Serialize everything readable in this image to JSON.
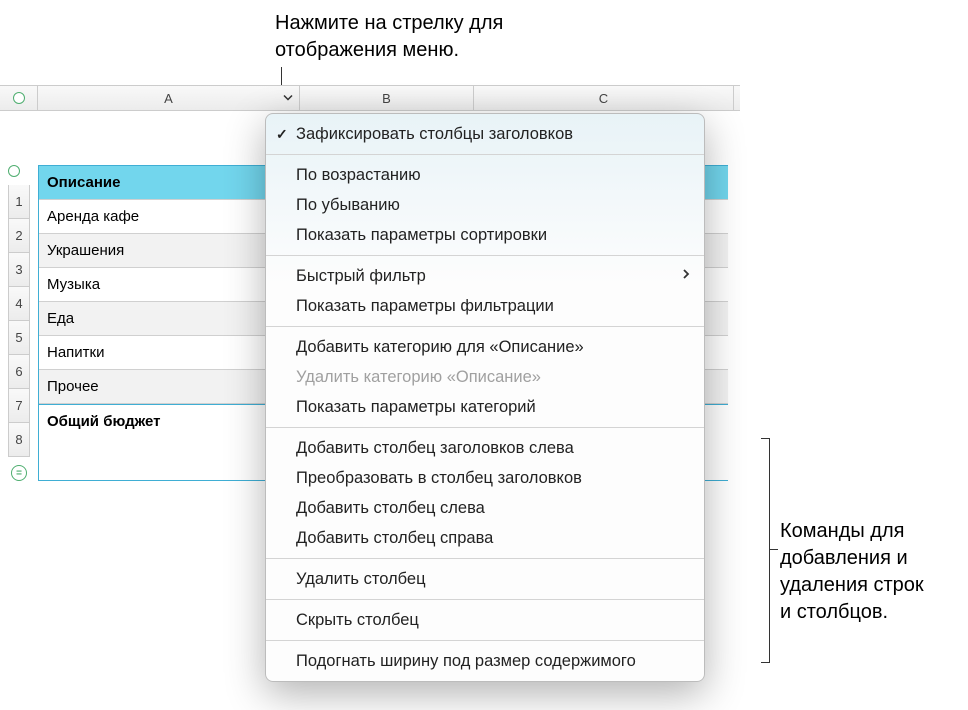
{
  "callouts": {
    "top": "Нажмите на стрелку для\nотображения меню.",
    "right": "Команды для\nдобавления и\nудаления строк\nи столбцов."
  },
  "columns": {
    "a": "A",
    "b": "B",
    "c": "C"
  },
  "rows": {
    "header": "Описание",
    "r2": "Аренда кафе",
    "r3": "Украшения",
    "r4": "Музыка",
    "r5": "Еда",
    "r6": "Напитки",
    "r7": "Прочее",
    "r8": "Общий бюджет"
  },
  "row_numbers": [
    "1",
    "2",
    "3",
    "4",
    "5",
    "6",
    "7",
    "8"
  ],
  "menu": {
    "freeze": "Зафиксировать столбцы заголовков",
    "asc": "По возрастанию",
    "desc": "По убыванию",
    "sort_opts": "Показать параметры сортировки",
    "quick_filter": "Быстрый фильтр",
    "filter_opts": "Показать параметры фильтрации",
    "add_cat": "Добавить категорию для «Описание»",
    "del_cat": "Удалить категорию «Описание»",
    "cat_opts": "Показать параметры категорий",
    "add_hdr_left": "Добавить столбец заголовков слева",
    "convert_hdr": "Преобразовать в столбец заголовков",
    "add_col_left": "Добавить столбец слева",
    "add_col_right": "Добавить столбец справа",
    "del_col": "Удалить столбец",
    "hide_col": "Скрыть столбец",
    "fit_width": "Подогнать ширину под размер содержимого"
  }
}
